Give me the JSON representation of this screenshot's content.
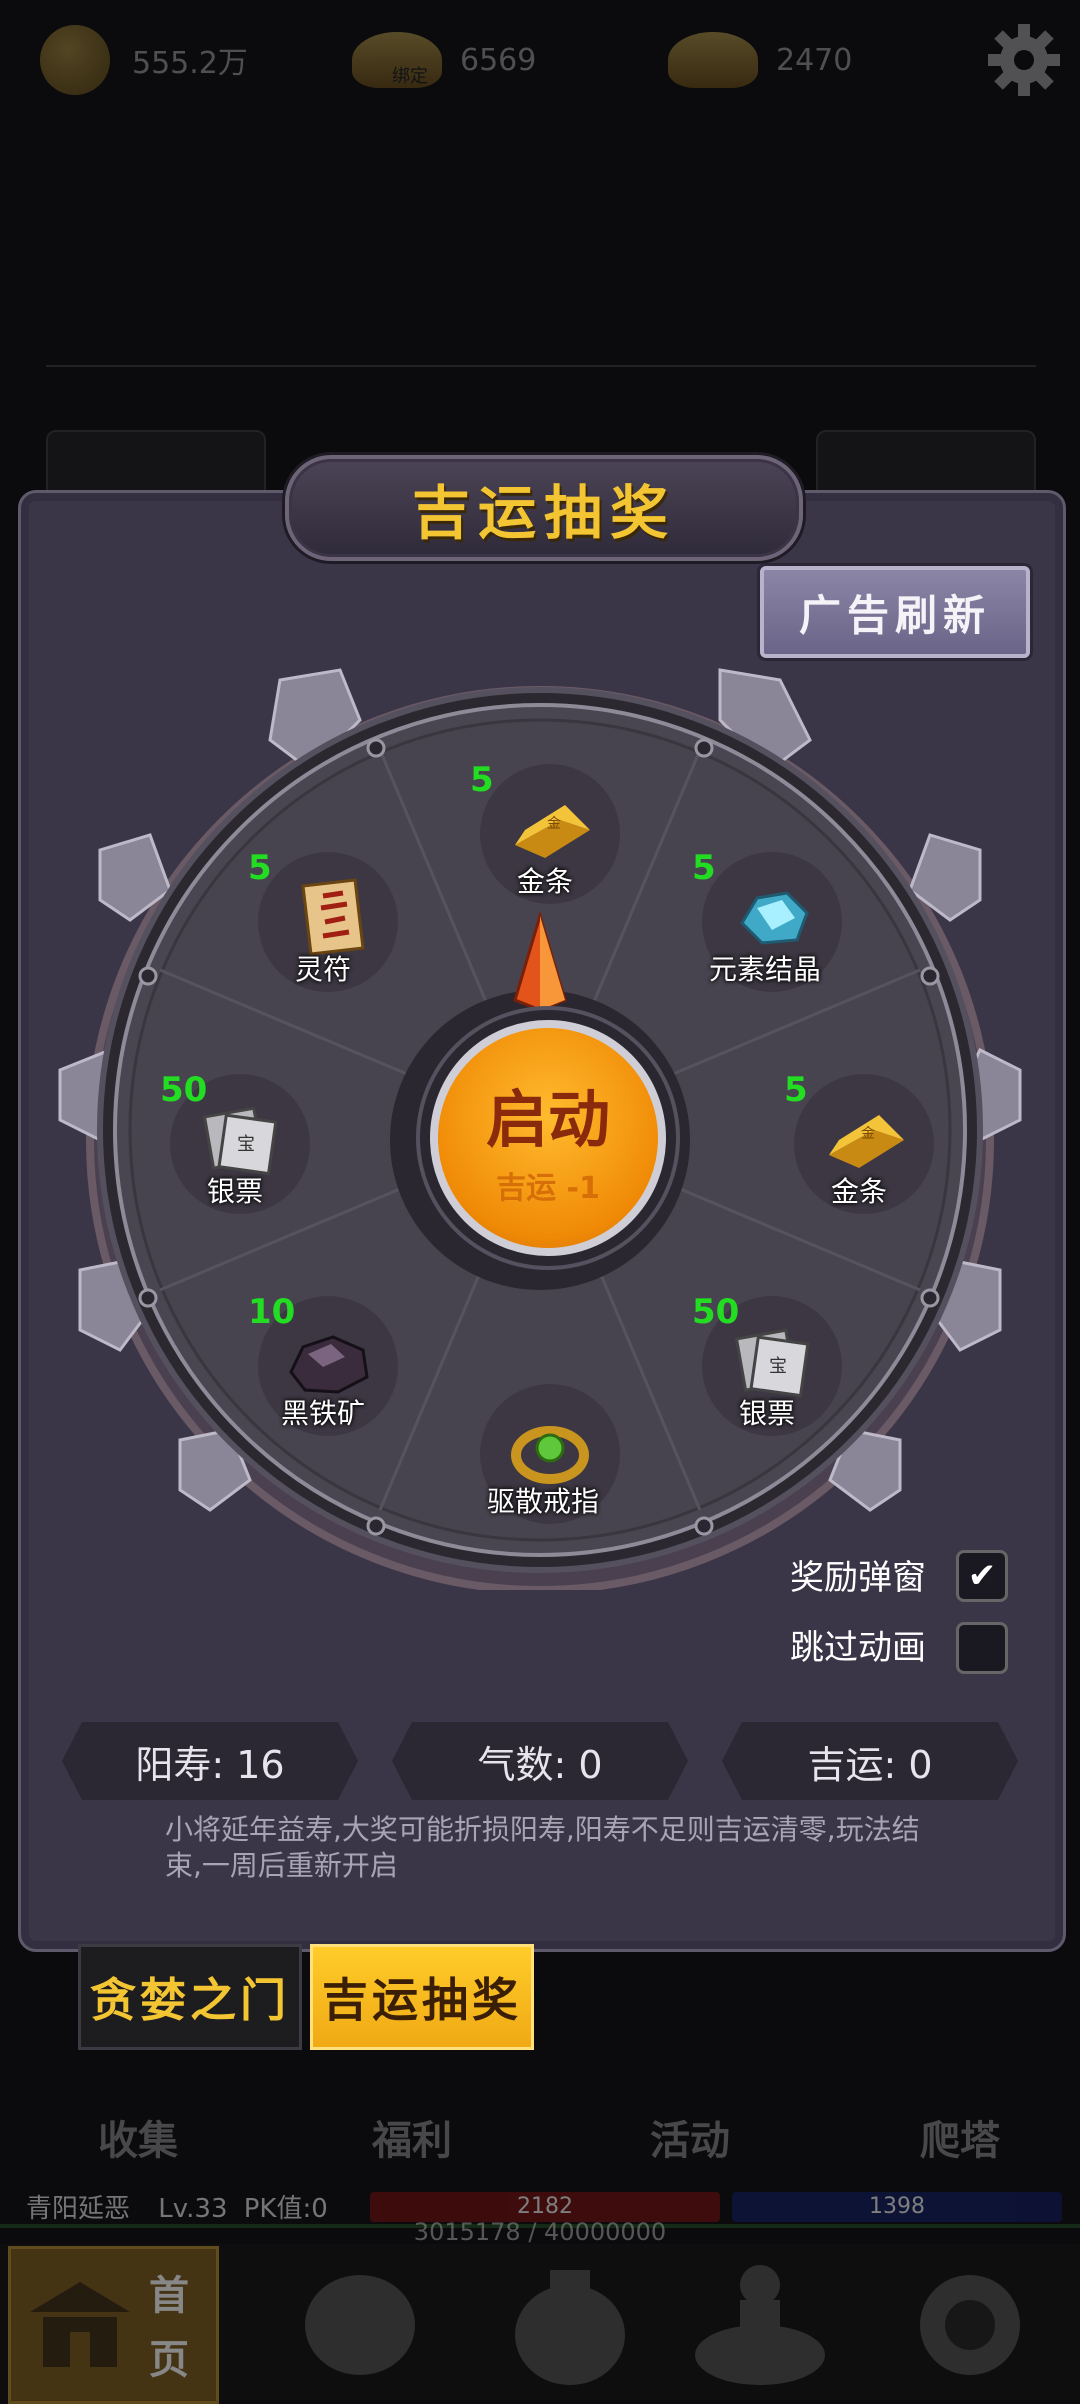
{
  "resources": [
    {
      "icon": "copper-coin-icon",
      "value": "555.2万"
    },
    {
      "icon": "bound-gold-ingot-icon",
      "value": "6569",
      "badge": "绑定"
    },
    {
      "icon": "gold-ingot-icon",
      "value": "2470"
    }
  ],
  "panel": {
    "title": "吉运抽奖",
    "ad_refresh_label": "广告刷新",
    "start_button": {
      "label": "启动",
      "cost": "吉运 -1"
    },
    "wheel_items": [
      {
        "name": "金条",
        "count": "5",
        "icon": "gold-bar-icon"
      },
      {
        "name": "元素结晶",
        "count": "5",
        "icon": "crystal-icon"
      },
      {
        "name": "金条",
        "count": "5",
        "icon": "gold-bar-icon"
      },
      {
        "name": "银票",
        "count": "50",
        "icon": "silver-note-icon"
      },
      {
        "name": "驱散戒指",
        "count": "",
        "icon": "ring-icon"
      },
      {
        "name": "黑铁矿",
        "count": "10",
        "icon": "iron-ore-icon"
      },
      {
        "name": "银票",
        "count": "50",
        "icon": "silver-note-icon"
      },
      {
        "name": "灵符",
        "count": "5",
        "icon": "talisman-icon"
      }
    ],
    "options": [
      {
        "label": "奖励弹窗",
        "checked": true
      },
      {
        "label": "跳过动画",
        "checked": false
      }
    ],
    "stats": {
      "lifespan": "阳寿: 16",
      "qi": "气数: 0",
      "luck": "吉运: 0"
    },
    "description": "小将延年益寿,大奖可能折损阳寿,阳寿不足则吉运清零,玩法结束,一周后重新开启"
  },
  "subtabs": [
    {
      "label": "贪婪之门",
      "active": false
    },
    {
      "label": "吉运抽奖",
      "active": true
    }
  ],
  "bottom_tabs": [
    "收集",
    "福利",
    "活动",
    "爬塔"
  ],
  "player": {
    "name": "青阳延恶",
    "level": "Lv.33",
    "pk": "PK值:0",
    "hp": "2182",
    "mp": "1398",
    "exp": "3015178 / 40000000"
  },
  "nav": {
    "home_label_1": "首",
    "home_label_2": "页"
  },
  "colors": {
    "accent_gold": "#f4c532",
    "count_green": "#22dd22",
    "panel_bg": "#3a3648"
  }
}
